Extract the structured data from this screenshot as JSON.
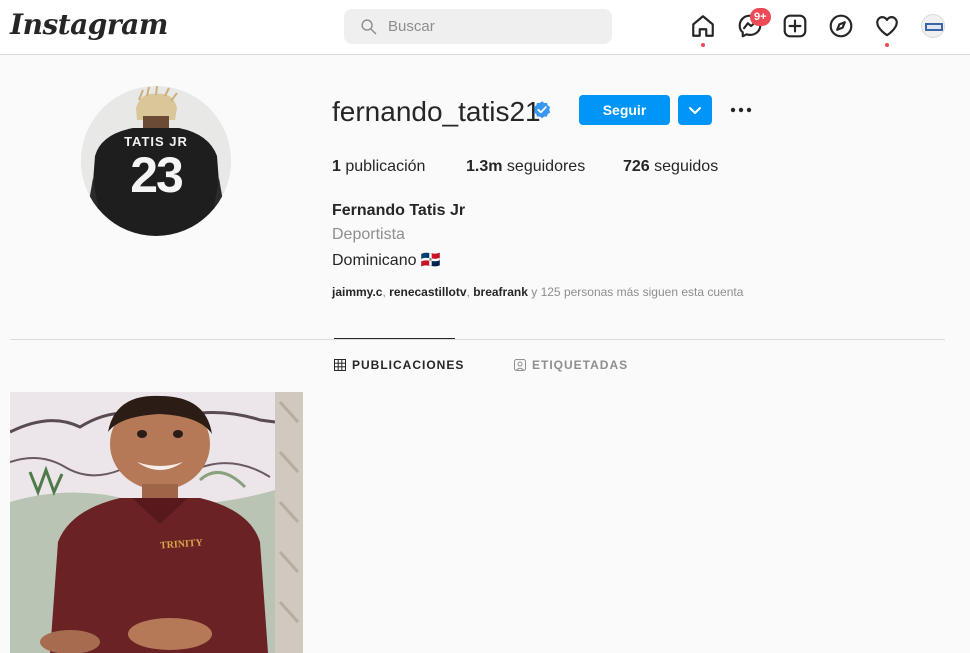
{
  "app": {
    "logo_text": "Instagram"
  },
  "search": {
    "placeholder": "Buscar"
  },
  "nav": {
    "icons": [
      "home-icon",
      "messenger-icon",
      "new-post-icon",
      "explore-icon",
      "activity-heart-icon"
    ],
    "messages_badge": "9+"
  },
  "profile": {
    "username": "fernando_tatis21",
    "follow_label": "Seguir",
    "stats": {
      "posts_count": "1",
      "posts_label": "publicación",
      "followers_count": "1.3m",
      "followers_label": "seguidores",
      "following_count": "726",
      "following_label": "seguidos"
    },
    "full_name": "Fernando Tatis Jr",
    "category": "Deportista",
    "bio": "Dominicano 🇩🇴",
    "followed_by": {
      "names": [
        "jaimmy.c",
        "renecastillotv",
        "breafrank"
      ],
      "suffix": "y 125 personas más siguen esta cuenta"
    },
    "jersey_name": "TATIS JR",
    "jersey_number": "23"
  },
  "tabs": {
    "posts_label": "PUBLICACIONES",
    "tagged_label": "ETIQUETADAS"
  },
  "post": {
    "shirt_text": "TRINITY"
  },
  "colors": {
    "accent": "#0095f6",
    "notification": "#ed4956",
    "verified": "#3897f0",
    "secondary_text": "#8e8e8e"
  }
}
